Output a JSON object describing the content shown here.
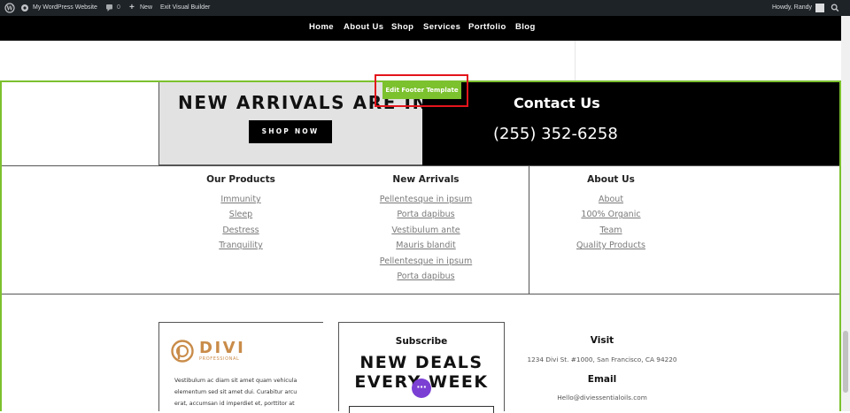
{
  "admin_bar": {
    "site_name": "My WordPress Website",
    "comments_count": "0",
    "new_label": "New",
    "exit_label": "Exit Visual Builder",
    "howdy": "Howdy, Randy"
  },
  "nav": {
    "items": [
      "Home",
      "About Us",
      "Shop",
      "Services",
      "Portfolio",
      "Blog"
    ]
  },
  "promo": {
    "headline": "NEW ARRIVALS ARE IN",
    "shop_button": "SHOP NOW",
    "edit_footer_label": "Edit Footer Template",
    "contact_title": "Contact Us",
    "phone": "(255) 352-6258"
  },
  "footer_columns": [
    {
      "heading": "Our Products",
      "links": [
        "Immunity",
        "Sleep",
        "Destress",
        "Tranquility"
      ]
    },
    {
      "heading": "New Arrivals",
      "links": [
        "Pellentesque in ipsum",
        "Porta dapibus",
        "Vestibulum ante",
        "Mauris blandit",
        "Pellentesque in ipsum",
        "Porta dapibus"
      ]
    },
    {
      "heading": "About Us",
      "links": [
        "About",
        "100% Organic",
        "Team",
        "Quality Products"
      ]
    }
  ],
  "brand": {
    "logo_text": "DIVI",
    "logo_subtext": "PROFESSIONAL",
    "blurb_lines": [
      "Vestibulum ac diam sit amet quam vehicula",
      "elementum sed sit amet dui. Curabitur arcu",
      "erat, accumsan id imperdiet et, porttitor at"
    ]
  },
  "subscribe": {
    "title": "Subscribe",
    "headline_line1": "NEW DEALS",
    "headline_line2": "EVERY WEEK"
  },
  "visit": {
    "title": "Visit",
    "address": "1234 Divi St. #1000, San Francisco, CA 94220",
    "email_title": "Email",
    "email": "Hello@diviessentialoils.com"
  },
  "colors": {
    "accent_green": "#7cc12e",
    "highlight_red": "#e3141b",
    "fab_purple": "#7b3fd4",
    "logo_orange": "#c98c4a"
  }
}
